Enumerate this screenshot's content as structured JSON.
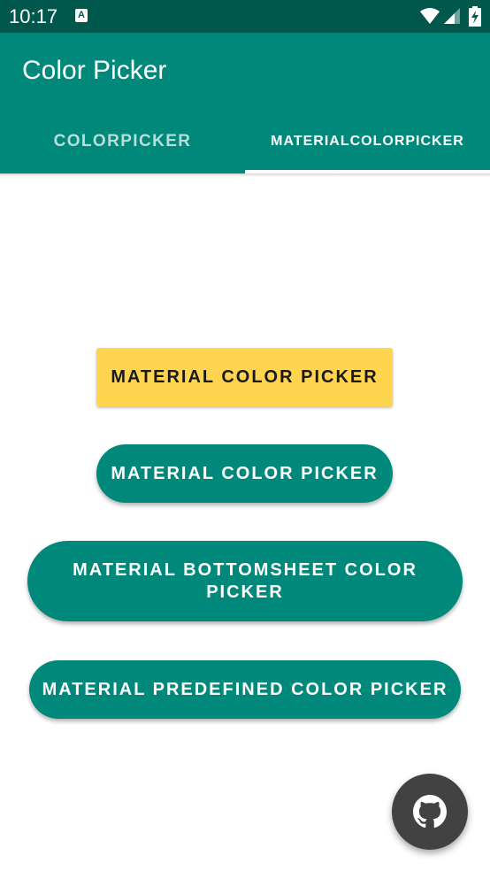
{
  "status_bar": {
    "time": "10:17",
    "notification_icon": "A",
    "icons": [
      "a-notification-icon",
      "wifi-icon",
      "signal-icon",
      "battery-charging-icon"
    ]
  },
  "app_bar": {
    "title": "Color Picker"
  },
  "tabs": [
    {
      "label": "COLORPICKER",
      "selected": false
    },
    {
      "label": "MATERIALCOLORPICKER",
      "selected": true
    }
  ],
  "buttons": {
    "material_color_picker_yellow": "MATERIAL COLOR PICKER",
    "material_color_picker": "MATERIAL COLOR PICKER",
    "material_bottomsheet_color_picker": "MATERIAL BOTTOMSHEET COLOR PICKER",
    "material_predefined_color_picker": "MATERIAL PREDEFINED COLOR PICKER"
  },
  "fab": {
    "icon": "github-icon"
  },
  "colors": {
    "status_bar": "#00574b",
    "primary": "#00897b",
    "accent_yellow": "#ffd54f",
    "fab": "#424242"
  }
}
